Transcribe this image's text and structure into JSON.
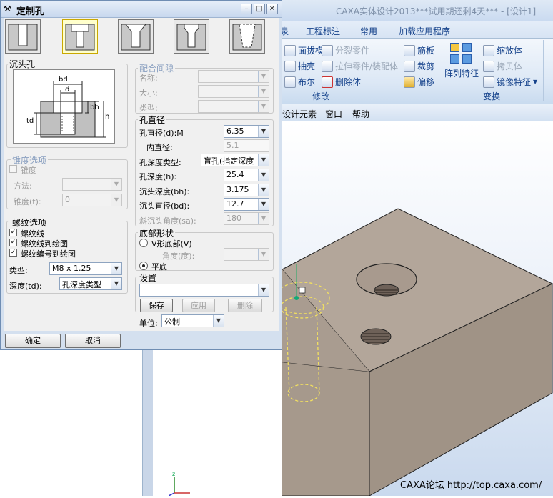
{
  "app": {
    "title": "CAXA实体设计2013***试用期还剩4天*** - [设计1]",
    "tabs": [
      "泉",
      "工程标注",
      "常用",
      "加载应用程序"
    ],
    "ribbon": {
      "modify_items": [
        {
          "label": "面拔模",
          "disabled": false
        },
        {
          "label": "分裂零件",
          "disabled": true
        },
        {
          "label": "抽壳",
          "disabled": false
        },
        {
          "label": "拉伸零件/装配体",
          "disabled": true
        },
        {
          "label": "布尔",
          "disabled": false
        },
        {
          "label": "删除体",
          "disabled": false
        }
      ],
      "modify_right": [
        "筋板",
        "裁剪",
        "偏移"
      ],
      "modify_group_label": "修改",
      "transform": {
        "array_label": "阵列特征",
        "items": [
          "缩放体",
          "拷贝体",
          "镜像特征"
        ],
        "group_label": "变换"
      }
    },
    "menu": [
      "设计元素",
      "窗口",
      "帮助"
    ],
    "watermark": "CAXA论坛 http://top.caxa.com/"
  },
  "dialog": {
    "title": "定制孔",
    "hole_section_title": "沉头孔",
    "diagram_labels": {
      "bd": "bd",
      "d": "d",
      "bh": "bh",
      "h": "h",
      "td": "td"
    },
    "taper": {
      "title": "锥度选项",
      "check_label": "锥度",
      "method_label": "方法:",
      "taper_label": "锥度(t):",
      "taper_value": "0"
    },
    "thread": {
      "title": "螺纹选项",
      "checks": [
        "螺纹线",
        "螺纹线到绘图",
        "螺纹编号到绘图"
      ],
      "type_label": "类型:",
      "type_value": "M8 x 1.25",
      "depth_label": "深度(td):",
      "depth_value": "孔深度类型"
    },
    "fit": {
      "title": "配合间隙",
      "name_label": "名称:",
      "size_label": "大小:",
      "type_label": "类型:"
    },
    "diameter": {
      "title": "孔直径",
      "rows": [
        {
          "label": "孔直径(d):M",
          "value": "6.35",
          "kind": "combo",
          "disabled": false
        },
        {
          "label": "内直径:",
          "value": "5.1",
          "kind": "text",
          "disabled": true
        },
        {
          "label": "孔深度类型:",
          "value": "盲孔(指定深度",
          "kind": "combo",
          "disabled": false
        },
        {
          "label": "孔深度(h):",
          "value": "25.4",
          "kind": "combo",
          "disabled": false
        },
        {
          "label": "沉头深度(bh):",
          "value": "3.175",
          "kind": "combo",
          "disabled": false
        },
        {
          "label": "沉头直径(bd):",
          "value": "12.7",
          "kind": "combo",
          "disabled": false
        },
        {
          "label": "斜沉头角度(sa):",
          "value": "180",
          "kind": "combo",
          "disabled": true
        }
      ]
    },
    "bottom": {
      "title": "底部形状",
      "v_label": "V形底部(V)",
      "angle_label": "角度(度):",
      "flat_label": "平底"
    },
    "settings": {
      "title": "设置",
      "save": "保存",
      "apply": "应用",
      "delete": "删除"
    },
    "unit_label": "单位:",
    "unit_value": "公制",
    "ok": "确定",
    "cancel": "取消"
  }
}
